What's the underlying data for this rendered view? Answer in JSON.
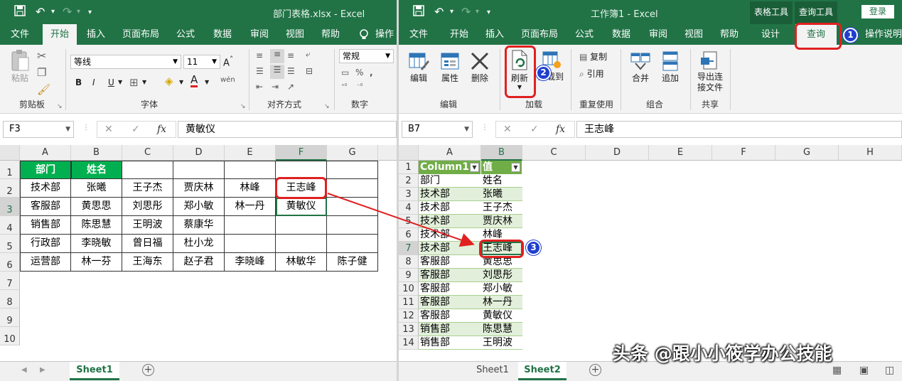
{
  "left": {
    "title": "部门表格.xlsx  -  Excel",
    "menu": [
      "文件",
      "开始",
      "插入",
      "页面布局",
      "公式",
      "数据",
      "审阅",
      "视图",
      "帮助",
      "操作"
    ],
    "ribbon": {
      "paste": "粘贴",
      "clipboard": "剪贴板",
      "font_name": "等线",
      "font_size": "11",
      "font_group": "字体",
      "bold": "B",
      "italic": "I",
      "underline": "U",
      "align_group": "对齐方式",
      "number_format": "常规",
      "number_group": "数字",
      "wen": "wén",
      "font_color_letter": "A"
    },
    "namebox": "F3",
    "fx": "fx",
    "formula": "黄敏仪",
    "columns": [
      "A",
      "B",
      "C",
      "D",
      "E",
      "F",
      "G"
    ],
    "rows": [
      "1",
      "2",
      "3",
      "4",
      "5",
      "6",
      "7",
      "8",
      "9",
      "10"
    ],
    "data": [
      [
        "部门",
        "姓名",
        "",
        "",
        "",
        "",
        ""
      ],
      [
        "技术部",
        "张曦",
        "王子杰",
        "贾庆林",
        "林峰",
        "王志峰",
        ""
      ],
      [
        "客服部",
        "黄思思",
        "刘思彤",
        "郑小敏",
        "林一丹",
        "黄敏仪",
        ""
      ],
      [
        "销售部",
        "陈思慧",
        "王明波",
        "蔡康华",
        "",
        "",
        ""
      ],
      [
        "行政部",
        "李晓敏",
        "曾日福",
        "杜小龙",
        "",
        "",
        ""
      ],
      [
        "运营部",
        "林一芬",
        "王海东",
        "赵子君",
        "李晓峰",
        "林敏华",
        "陈子健"
      ]
    ],
    "sheets": [
      "Sheet1"
    ]
  },
  "right": {
    "title": "工作簿1  -  Excel",
    "context_tabs": [
      "表格工具",
      "查询工具"
    ],
    "login": "登录",
    "menu": [
      "文件",
      "开始",
      "插入",
      "页面布局",
      "公式",
      "数据",
      "审阅",
      "视图",
      "帮助",
      "设计",
      "查询",
      "操作说明"
    ],
    "ribbon": {
      "edit": "编辑",
      "properties": "属性",
      "delete": "删除",
      "edit_group": "编辑",
      "refresh": "刷新",
      "load_to": "加载到",
      "load_group": "加载",
      "duplicate": "复制",
      "reference": "引用",
      "reuse_group": "重复使用",
      "merge": "合并",
      "append": "追加",
      "combine_group": "组合",
      "export": "导出连接文件",
      "export_1": "导出连",
      "export_2": "接文件",
      "share_group": "共享"
    },
    "namebox": "B7",
    "fx": "fx",
    "formula": "王志峰",
    "columns": [
      "A",
      "B",
      "C",
      "D",
      "E",
      "F",
      "G",
      "H"
    ],
    "table_headers": [
      "Column1",
      "值"
    ],
    "rows": [
      "1",
      "2",
      "3",
      "4",
      "5",
      "6",
      "7",
      "8",
      "9",
      "10",
      "11",
      "12",
      "13",
      "14"
    ],
    "data": [
      [
        "部门",
        "姓名"
      ],
      [
        "技术部",
        "张曦"
      ],
      [
        "技术部",
        "王子杰"
      ],
      [
        "技术部",
        "贾庆林"
      ],
      [
        "技术部",
        "林峰"
      ],
      [
        "技术部",
        "王志峰"
      ],
      [
        "客服部",
        "黄思思"
      ],
      [
        "客服部",
        "刘思彤"
      ],
      [
        "客服部",
        "郑小敏"
      ],
      [
        "客服部",
        "林一丹"
      ],
      [
        "客服部",
        "黄敏仪"
      ],
      [
        "销售部",
        "陈思慧"
      ],
      [
        "销售部",
        "王明波"
      ]
    ],
    "sheets": [
      "Sheet1",
      "Sheet2"
    ]
  },
  "badges": [
    "1",
    "2",
    "3"
  ],
  "watermark": "头条 @跟小小筱学办公技能",
  "colors": {
    "excel_green": "#217346",
    "table_band": "#e2efda",
    "table_header": "#70ad47",
    "header_green": "#00b050",
    "callout_red": "#e02020",
    "badge_blue": "#1f3fcf"
  }
}
